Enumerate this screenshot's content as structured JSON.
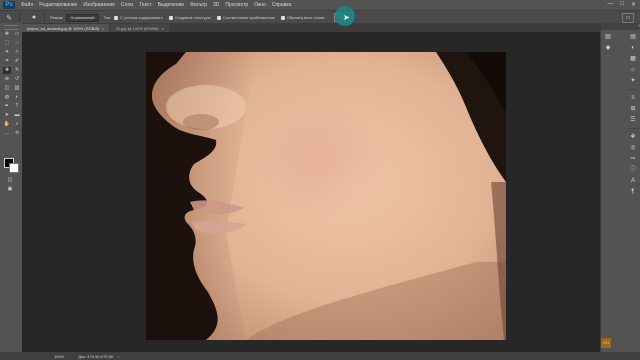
{
  "app": {
    "logo_text": "Ps"
  },
  "menubar": {
    "items": [
      "Файл",
      "Редактирование",
      "Изображение",
      "Слои",
      "Текст",
      "Выделение",
      "Фильтр",
      "3D",
      "Просмотр",
      "Окно",
      "Справка"
    ],
    "window_controls": [
      "—",
      "□",
      "✕"
    ]
  },
  "options": {
    "tool_icon": "spot-healing-brush-icon",
    "tool_glyph": "✎",
    "brush_glyph": "●",
    "mode_label": "Режим:",
    "mode_value": "Нормальный",
    "type_label": "Тип:",
    "type_value": "С учетом содержимого",
    "create_texture": "Создание текстуры",
    "proximity_match": "Соответствие приближению",
    "sample_all_layers": "Образец всех слоев",
    "pressure_glyph": "◐",
    "workspace_glyph": "▭"
  },
  "tabs": [
    {
      "label": "psylus_ka_aciokali.jpg @ 100% (RGB/8)",
      "close": "×",
      "active": true
    },
    {
      "label": "25.jpg @ 100% (RGB/8)",
      "close": "×",
      "active": false
    }
  ],
  "tools": {
    "icons": [
      "move-icon",
      "artboard-icon",
      "marquee-icon",
      "lasso-icon",
      "quick-select-icon",
      "magic-wand-icon",
      "crop-icon",
      "eyedropper-icon",
      "spot-healing-icon",
      "brush-icon",
      "clone-stamp-icon",
      "history-brush-icon",
      "eraser-icon",
      "gradient-icon",
      "blur-icon",
      "dodge-icon",
      "pen-icon",
      "type-icon",
      "path-select-icon",
      "shape-icon",
      "hand-icon",
      "zoom-icon",
      "more-tools-icon",
      "rotate-view-icon"
    ],
    "glyphs": [
      "✥",
      "▭",
      "⬚",
      "◌",
      "✦",
      "✧",
      "⌗",
      "✐",
      "✚",
      "✎",
      "⊕",
      "↺",
      "◫",
      "▥",
      "◍",
      "◐",
      "✒",
      "T",
      "➤",
      "▬",
      "✋",
      "⌕",
      "…",
      "⟲"
    ],
    "selected_index": 8,
    "extras": [
      "◫",
      "▣"
    ]
  },
  "dock": {
    "collapse_glyph": "«",
    "mini_glyphs": [
      "▤",
      "◆"
    ],
    "icons": [
      "history-icon",
      "color-icon",
      "swatches-icon",
      "adjustments-icon",
      "styles-icon",
      "brush-panel-icon",
      "clone-source-icon",
      "properties-icon",
      "layers-icon",
      "channels-icon",
      "paths-icon",
      "info-icon",
      "character-icon",
      "paragraph-icon"
    ],
    "glyphs": [
      "▤",
      "◐",
      "▦",
      "☼",
      "✦",
      "≡",
      "⊞",
      "☰",
      "❖",
      "◎",
      "✑",
      "ⓘ",
      "A",
      "¶"
    ],
    "logo_text": "CH"
  },
  "cursor": {
    "glyph": "➤"
  },
  "status": {
    "zoom": "100%",
    "doc_info": "Док: 475,9K/475,9K",
    "arrow": "›"
  },
  "photo": {
    "subject": "close-up face profile, cheek and chin",
    "bg_color": "#1a0f0a",
    "skin_color": "#e4b89a",
    "skin_shadow": "#b8846a",
    "hair_color": "#1f140e",
    "lip_color": "#d49a8a"
  }
}
